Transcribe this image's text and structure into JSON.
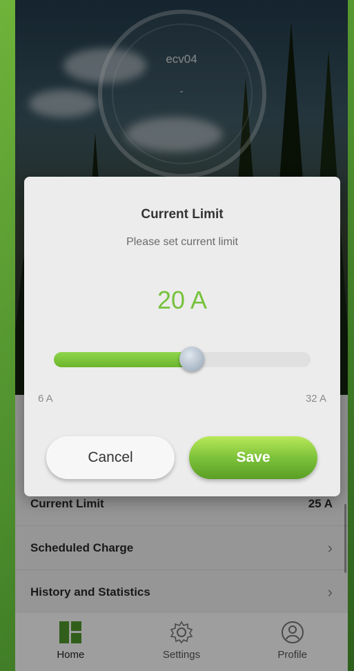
{
  "device": {
    "name": "ecv04",
    "status": "-"
  },
  "list": {
    "rows": [
      {
        "label": "Current Limit",
        "value": "25 A"
      },
      {
        "label": "Scheduled Charge",
        "value": ""
      },
      {
        "label": "History and Statistics",
        "value": ""
      }
    ]
  },
  "tabs": [
    {
      "label": "Home",
      "icon": "home-icon",
      "active": true
    },
    {
      "label": "Settings",
      "icon": "gear-icon",
      "active": false
    },
    {
      "label": "Profile",
      "icon": "profile-icon",
      "active": false
    }
  ],
  "modal": {
    "title": "Current Limit",
    "subtitle": "Please set current limit",
    "value_text": "20 A",
    "min_label": "6 A",
    "max_label": "32 A",
    "slider": {
      "min": 6,
      "max": 32,
      "value": 20
    },
    "cancel_label": "Cancel",
    "save_label": "Save"
  },
  "colors": {
    "accent": "#76c23c",
    "active_tab": "#4f9a2d"
  }
}
